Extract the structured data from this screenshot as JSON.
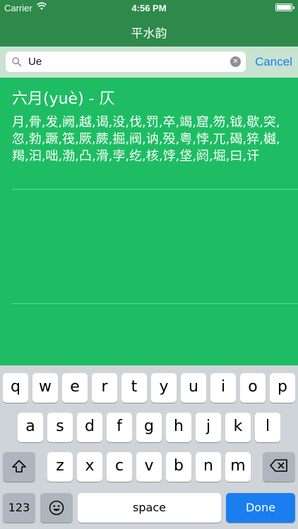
{
  "status_bar": {
    "carrier": "Carrier",
    "time": "4:56 PM"
  },
  "nav": {
    "title": "平水韵"
  },
  "search": {
    "query": "Ue",
    "cancel_label": "Cancel"
  },
  "result": {
    "heading": "六月(yuè) - 仄",
    "characters": "月,骨,发,阙,越,谒,没,伐,罚,卒,竭,窟,笏,钺,歇,突,忽,勃,蹶,筏,厥,蕨,掘,阀,讷,殁,粤,悖,兀,碣,猝,樾,羯,汩,咄,渤,凸,滑,孛,纥,核,饽,垡,阏,堀,曰,讦"
  },
  "keyboard": {
    "row1": [
      "q",
      "w",
      "e",
      "r",
      "t",
      "y",
      "u",
      "i",
      "o",
      "p"
    ],
    "row2": [
      "a",
      "s",
      "d",
      "f",
      "g",
      "h",
      "j",
      "k",
      "l"
    ],
    "row3": [
      "z",
      "x",
      "c",
      "v",
      "b",
      "n",
      "m"
    ],
    "numbers_label": "123",
    "space_label": "space",
    "done_label": "Done"
  },
  "colors": {
    "nav_background": "#2e8a4a",
    "content_background": "#1ebd63",
    "accent": "#1a7ef0"
  }
}
